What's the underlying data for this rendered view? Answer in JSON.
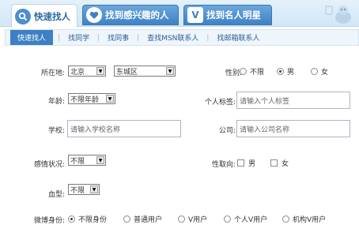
{
  "top_tabs": [
    {
      "label": "快速找人",
      "icon": "search-icon"
    },
    {
      "label": "找到感兴趣的人",
      "icon": "heart-icon"
    },
    {
      "label": "找到名人明星",
      "icon": "v-icon"
    }
  ],
  "sub_nav": [
    "快速找人",
    "找同学",
    "找同事",
    "查找MSN联系人",
    "找邮箱联系人"
  ],
  "sub_sep": "|",
  "form": {
    "location": {
      "label": "所在地:",
      "province": "北京",
      "district": "东城区"
    },
    "gender": {
      "label": "性别:",
      "options": [
        "不限",
        "男",
        "女"
      ],
      "selected": "男"
    },
    "age": {
      "label": "年龄:",
      "value": "不限年龄"
    },
    "tag": {
      "label": "个人标签:",
      "placeholder": "请输入个人标签"
    },
    "school": {
      "label": "学校:",
      "placeholder": "请输入学校名称"
    },
    "company": {
      "label": "公司:",
      "placeholder": "请输入公司名称"
    },
    "relationship": {
      "label": "感情状况:",
      "value": "不限"
    },
    "orientation": {
      "label": "性取向:",
      "options": [
        "男",
        "女"
      ]
    },
    "blood": {
      "label": "血型:",
      "value": "不限"
    },
    "weibo_identity": {
      "label": "微博身份:",
      "options": [
        "不限身份",
        "普通用户",
        "V用户",
        "个人V用户",
        "机构V用户"
      ],
      "selected": "不限身份"
    }
  },
  "colors": {
    "accent": "#3d80c3",
    "tab_bg": "#d2e7f7"
  }
}
